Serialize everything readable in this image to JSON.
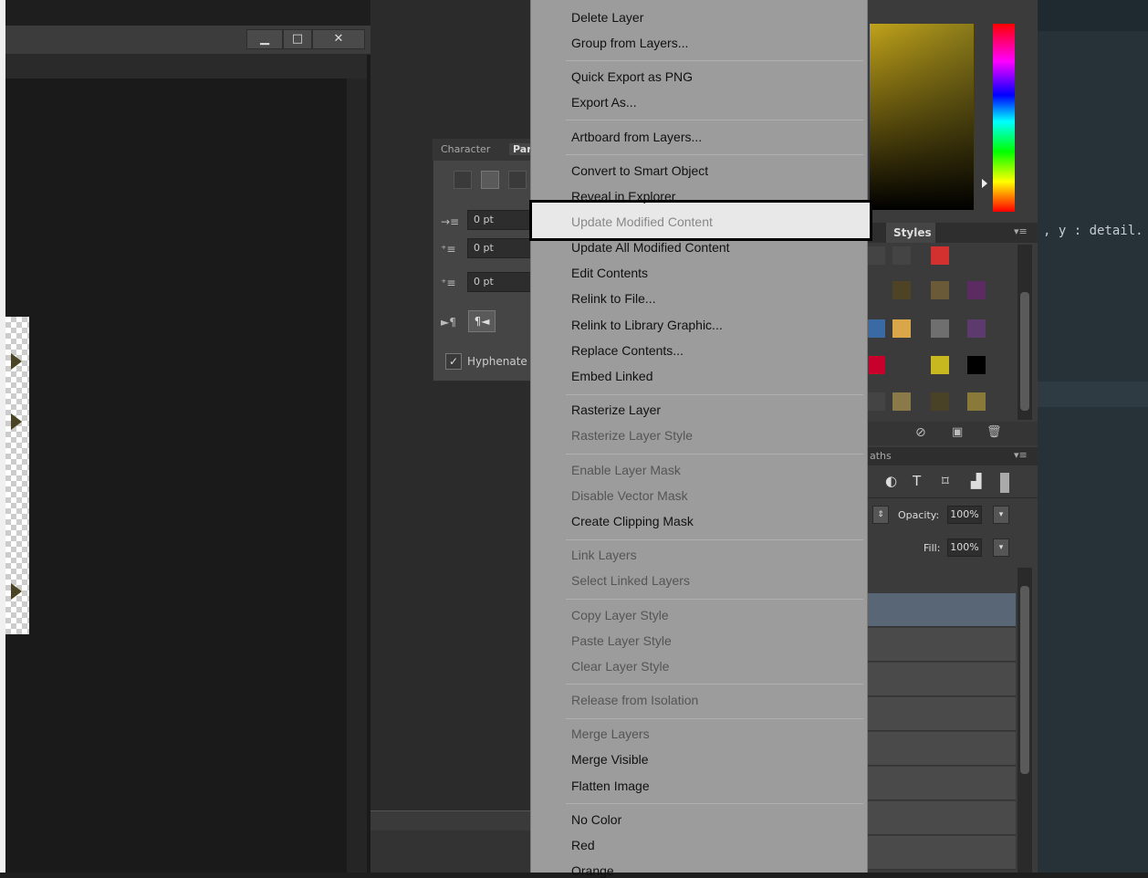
{
  "document_window": {
    "buttons": {
      "minimize": "▁",
      "maximize": "□",
      "close": "✕"
    }
  },
  "paragraph_panel": {
    "tabs": [
      "Character",
      "Par"
    ],
    "fields": [
      "0 pt",
      "0 pt",
      "0 pt"
    ],
    "hyphenate_label": "Hyphenate",
    "hyphenate_checked": true
  },
  "context_menu": {
    "items": [
      {
        "label": "Delete Layer",
        "enabled": true
      },
      {
        "label": "Group from Layers...",
        "enabled": true
      },
      {
        "label": "Quick Export as PNG",
        "enabled": true
      },
      {
        "label": "Export As...",
        "enabled": true
      },
      {
        "label": "Artboard from Layers...",
        "enabled": true
      },
      {
        "label": "Convert to Smart Object",
        "enabled": true
      },
      {
        "label": "Reveal in Explorer",
        "enabled": true
      },
      {
        "label": "Update Modified Content",
        "enabled": false,
        "highlighted": true
      },
      {
        "label": "Update All Modified Content",
        "enabled": true
      },
      {
        "label": "Edit Contents",
        "enabled": true
      },
      {
        "label": "Relink to File...",
        "enabled": true
      },
      {
        "label": "Relink to Library Graphic...",
        "enabled": true
      },
      {
        "label": "Replace Contents...",
        "enabled": true
      },
      {
        "label": "Embed Linked",
        "enabled": true
      },
      {
        "label": "Rasterize Layer",
        "enabled": true
      },
      {
        "label": "Rasterize Layer Style",
        "enabled": false
      },
      {
        "label": "Enable Layer Mask",
        "enabled": false
      },
      {
        "label": "Disable Vector Mask",
        "enabled": false
      },
      {
        "label": "Create Clipping Mask",
        "enabled": true
      },
      {
        "label": "Link Layers",
        "enabled": false
      },
      {
        "label": "Select Linked Layers",
        "enabled": false
      },
      {
        "label": "Copy Layer Style",
        "enabled": false
      },
      {
        "label": "Paste Layer Style",
        "enabled": false
      },
      {
        "label": "Clear Layer Style",
        "enabled": false
      },
      {
        "label": "Release from Isolation",
        "enabled": false
      },
      {
        "label": "Merge Layers",
        "enabled": false
      },
      {
        "label": "Merge Visible",
        "enabled": true
      },
      {
        "label": "Flatten Image",
        "enabled": true
      },
      {
        "label": "No Color",
        "enabled": true
      },
      {
        "label": "Red",
        "enabled": true
      },
      {
        "label": "Orange",
        "enabled": true
      }
    ]
  },
  "styles_panel": {
    "tab": "Styles",
    "swatch_colors": [
      "#444444",
      "#444444",
      "#d33030",
      "#3b3b3b",
      "#3b3b3b",
      "#4f4326",
      "#6a5a38",
      "#5b2b62",
      "#3a6aa3",
      "#d9a64a",
      "#6f6f6f",
      "#5c3a6e",
      "#c8002c",
      "#3b3b3b",
      "#c8b820",
      "#000000",
      "#444444",
      "#8a7a4a",
      "#4a4226",
      "#8a7a3a"
    ]
  },
  "layers_panel": {
    "tab_fragment": "aths",
    "opacity_label": "Opacity:",
    "opacity_value": "100%",
    "fill_label": "Fill:",
    "fill_value": "100%"
  },
  "editor": {
    "code_line": ", y : detail."
  },
  "colors": {
    "menu_bg": "#9c9c9c",
    "highlight_border": "#000000",
    "editor_bg": "#263238"
  }
}
